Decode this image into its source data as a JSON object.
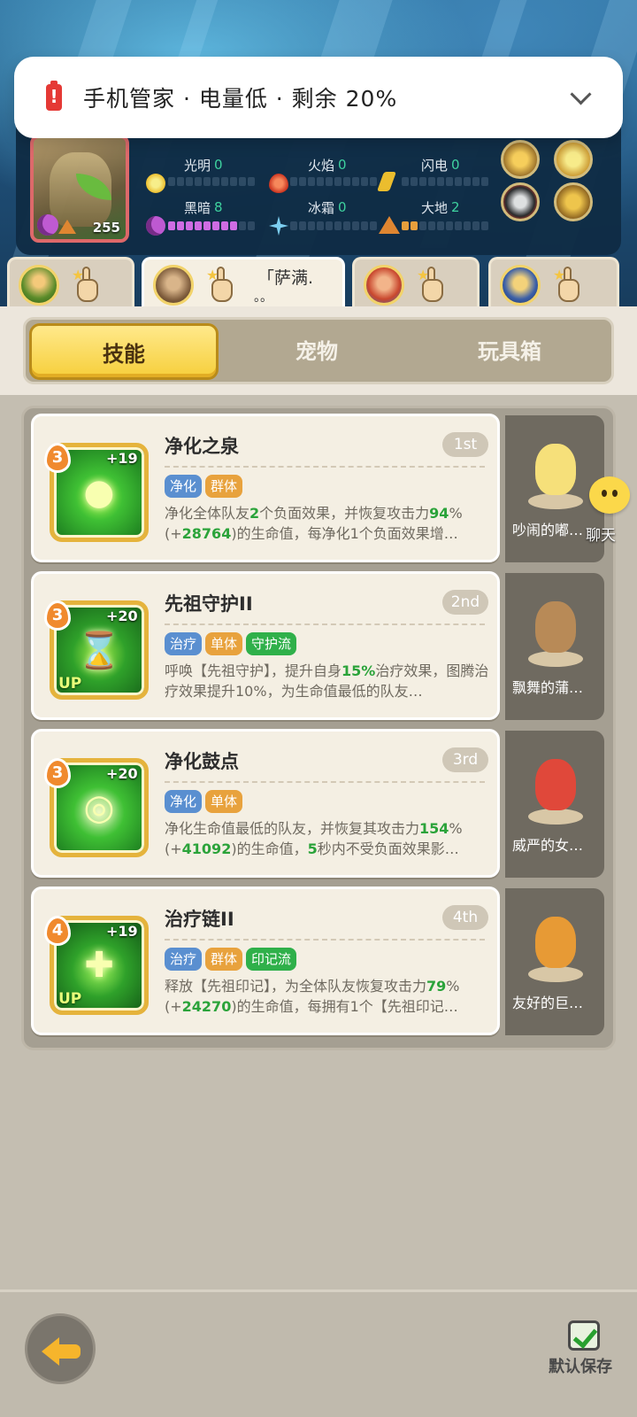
{
  "notification": {
    "text": "手机管家 · 电量低 · 剩余 20%",
    "icon": "battery-low-icon"
  },
  "hero": {
    "level": "255",
    "elements": [
      {
        "name": "光明",
        "value": "0"
      },
      {
        "name": "火焰",
        "value": "0"
      },
      {
        "name": "闪电",
        "value": "0"
      },
      {
        "name": "黑暗",
        "value": "8"
      },
      {
        "name": "冰霜",
        "value": "0"
      },
      {
        "name": "大地",
        "value": "2"
      }
    ]
  },
  "characters": [
    {
      "name": ""
    },
    {
      "name": "「萨满.",
      "sub": "。。"
    },
    {
      "name": ""
    },
    {
      "name": ""
    }
  ],
  "tabs": [
    "技能",
    "宠物",
    "玩具箱"
  ],
  "skills": [
    {
      "title": "净化之泉",
      "rank": "1st",
      "cost": "3",
      "plus": "+19",
      "up": "",
      "tags": [
        "净化",
        "群体"
      ],
      "desc_parts": [
        "净化全体队友",
        "2",
        "个负面效果，并恢复攻击力",
        "94",
        "%(+",
        "28764",
        ")的生命值，每净化1个负面效果增…"
      ]
    },
    {
      "title": "先祖守护II",
      "rank": "2nd",
      "cost": "3",
      "plus": "+20",
      "up": "UP",
      "tags": [
        "治疗",
        "单体",
        "守护流"
      ],
      "desc_parts": [
        "呼唤【先祖守护】，提升自身",
        "15%",
        "治疗效果，图腾治疗效果提升10%，为生命值最低的队友…"
      ]
    },
    {
      "title": "净化鼓点",
      "rank": "3rd",
      "cost": "3",
      "plus": "+20",
      "up": "",
      "tags": [
        "净化",
        "单体"
      ],
      "desc_parts": [
        "净化生命值最低的队友，并恢复其攻击力",
        "154",
        "%(+",
        "41092",
        ")的生命值，",
        "5",
        "秒内不受负面效果影…"
      ]
    },
    {
      "title": "治疗链II",
      "rank": "4th",
      "cost": "4",
      "plus": "+19",
      "up": "UP",
      "tags": [
        "治疗",
        "群体",
        "印记流"
      ],
      "desc_parts": [
        "释放【先祖印记】，为全体队友恢复攻击力",
        "79",
        "%(+",
        "24270",
        ")的生命值，每拥有1个【先祖印记…"
      ]
    }
  ],
  "pets": [
    {
      "name": "吵闹的嘟…",
      "color": "#f6e07a"
    },
    {
      "name": "飘舞的蒲…",
      "color": "#b88a57"
    },
    {
      "name": "威严的女…",
      "color": "#e0483a"
    },
    {
      "name": "友好的巨…",
      "color": "#e79a35"
    }
  ],
  "chat": {
    "label": "聊天"
  },
  "bottom": {
    "save_label": "默认保存"
  }
}
